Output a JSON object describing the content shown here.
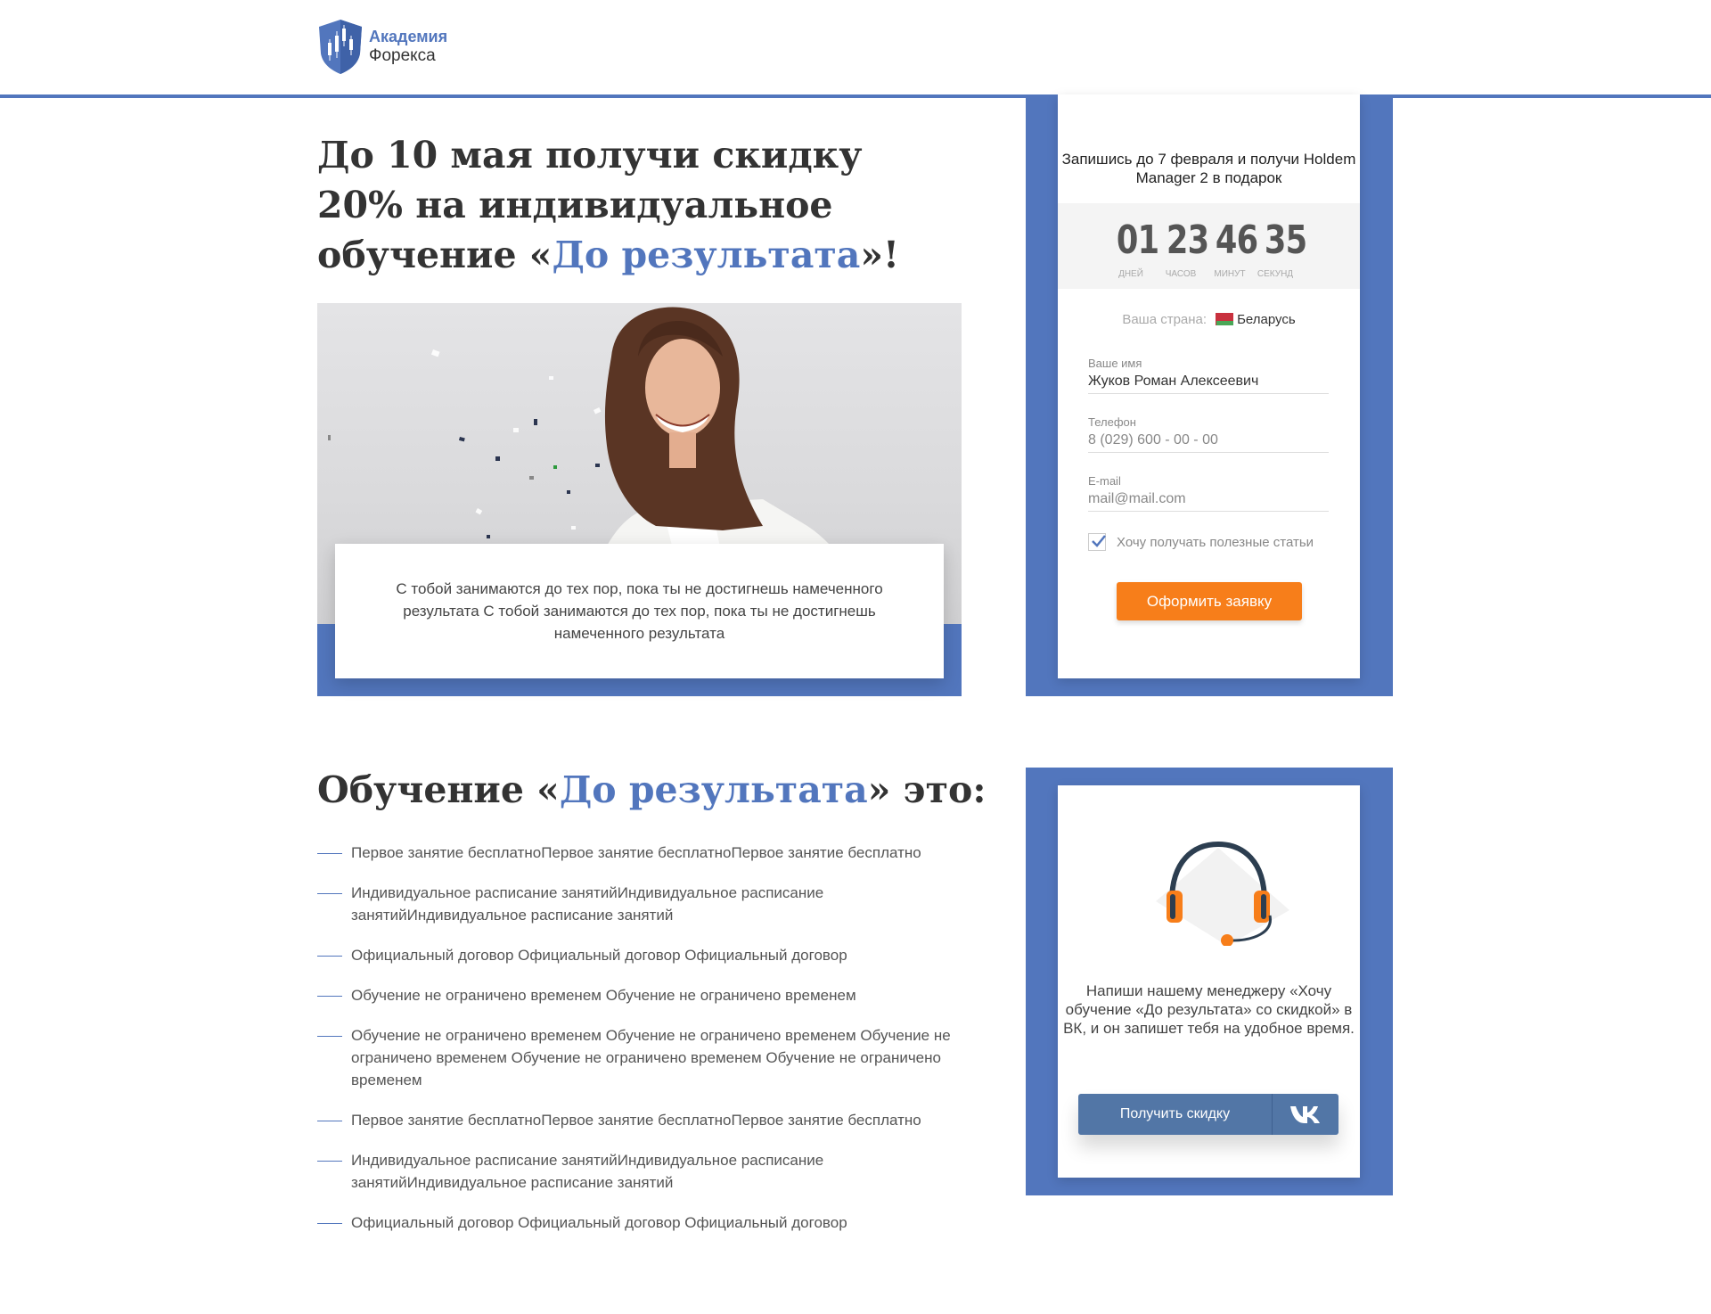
{
  "header": {
    "logo_line1": "Академия",
    "logo_line2": "Форекса"
  },
  "hero": {
    "title_part1": "До 10 мая получи скидку 20% на индивидуальное обучение «",
    "title_accent": "До результата",
    "title_part2": "»!",
    "quote": "С тобой занимаются до тех пор, пока ты не достигнешь намеченного результата С тобой занимаются до тех пор, пока ты не достигнешь намеченного результата"
  },
  "form": {
    "title": "Запишись до 7 февраля и получи Holdem Manager 2 в подарок",
    "timer": {
      "days": "01",
      "hours": "23",
      "minutes": "46",
      "seconds": "35",
      "days_label": "дней",
      "hours_label": "часов",
      "minutes_label": "минут",
      "seconds_label": "секунд"
    },
    "country_label": "Ваша страна:",
    "country_value": "Беларусь",
    "name_label": "Ваше имя",
    "name_value": "Жуков Роман Алексеевич",
    "phone_label": "Телефон",
    "phone_placeholder": "8 (029) 600 - 00 - 00",
    "email_label": "E-mail",
    "email_placeholder": "mail@mail.com",
    "checkbox_label": "Хочу получать полезные статьи",
    "checkbox_checked": true,
    "submit_label": "Оформить заявку"
  },
  "section2": {
    "title_part1": "Обучение «",
    "title_accent": "До результата",
    "title_part2": "» это:",
    "items": [
      "Первое занятие бесплатноПервое занятие бесплатноПервое занятие бесплатно",
      "Индивидуальное расписание занятийИндивидуальное расписание занятийИндивидуальное расписание занятий",
      "Официальный договор Официальный договор  Официальный договор",
      "Обучение не ограничено временем  Обучение не ограничено временем",
      "Обучение не ограничено временем Обучение не ограничено временем Обучение не ограничено временем Обучение не ограничено временем Обучение не ограничено временем",
      "Первое занятие бесплатноПервое занятие бесплатноПервое занятие бесплатно",
      "Индивидуальное расписание занятийИндивидуальное расписание занятийИндивидуальное расписание занятий",
      "Официальный договор Официальный договор  Официальный договор"
    ]
  },
  "support": {
    "text": "Напиши нашему менеджеру «Хочу обучение «До результата» со скидкой» в ВК, и он запишет тебя на удобное время.",
    "button_label": "Получить скидку",
    "icon": "vk-icon"
  },
  "colors": {
    "accent": "#5276bd",
    "button_orange": "#f77e1a",
    "vk_button": "#5276a6"
  }
}
